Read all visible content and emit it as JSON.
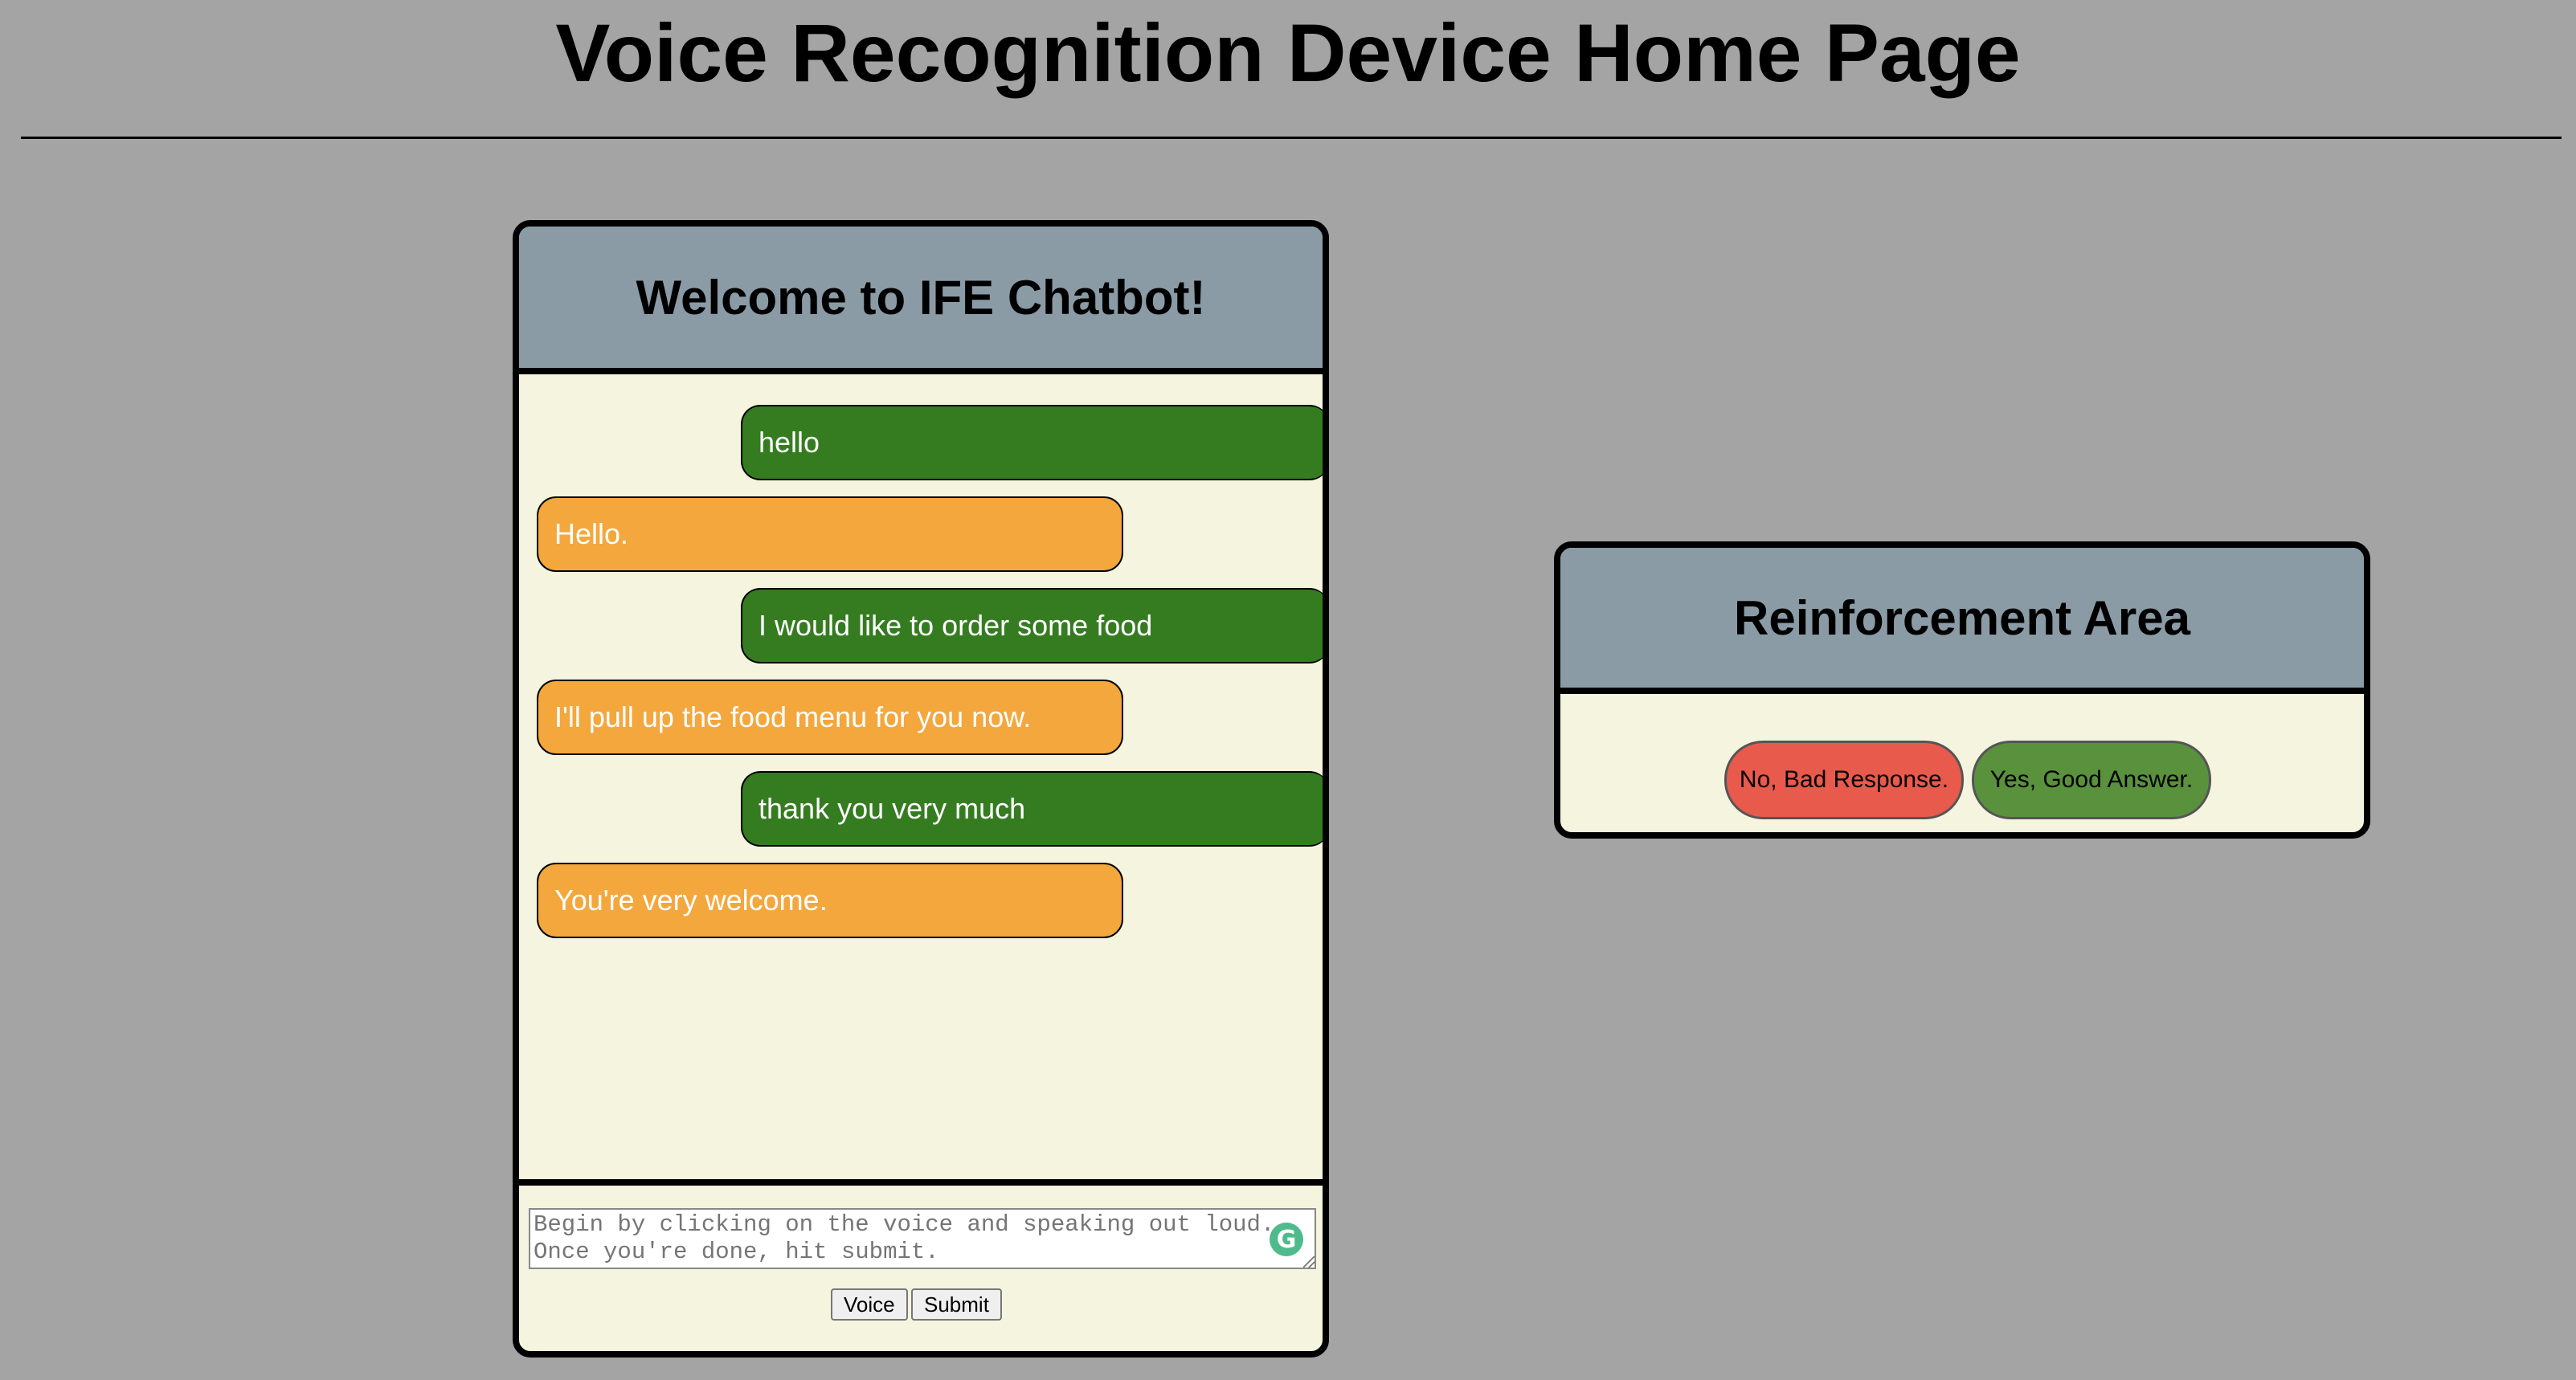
{
  "page": {
    "title": "Voice Recognition Device Home Page"
  },
  "chat": {
    "header": "Welcome to IFE Chatbot!",
    "messages": [
      {
        "sender": "user",
        "text": "hello"
      },
      {
        "sender": "bot",
        "text": "Hello."
      },
      {
        "sender": "user",
        "text": "I would like to order some food"
      },
      {
        "sender": "bot",
        "text": "I'll pull up the food menu for you now."
      },
      {
        "sender": "user",
        "text": "thank you very much"
      },
      {
        "sender": "bot",
        "text": "You're very welcome."
      }
    ],
    "input": {
      "placeholder": "Begin by clicking on the voice and speaking out loud. Once you're done, hit submit.",
      "value": ""
    },
    "voice_label": "Voice",
    "submit_label": "Submit",
    "grammarly_icon": "G"
  },
  "reinforcement": {
    "header": "Reinforcement Area",
    "bad_label": "No, Bad Response.",
    "good_label": "Yes, Good Answer."
  },
  "colors": {
    "background": "#a4a4a4",
    "panel_header": "#8a9ba6",
    "panel_body": "#f5f5df",
    "user_bubble": "#357c21",
    "bot_bubble": "#f3a73d",
    "bad_button": "#e85a4c",
    "good_button": "#5a913d"
  }
}
